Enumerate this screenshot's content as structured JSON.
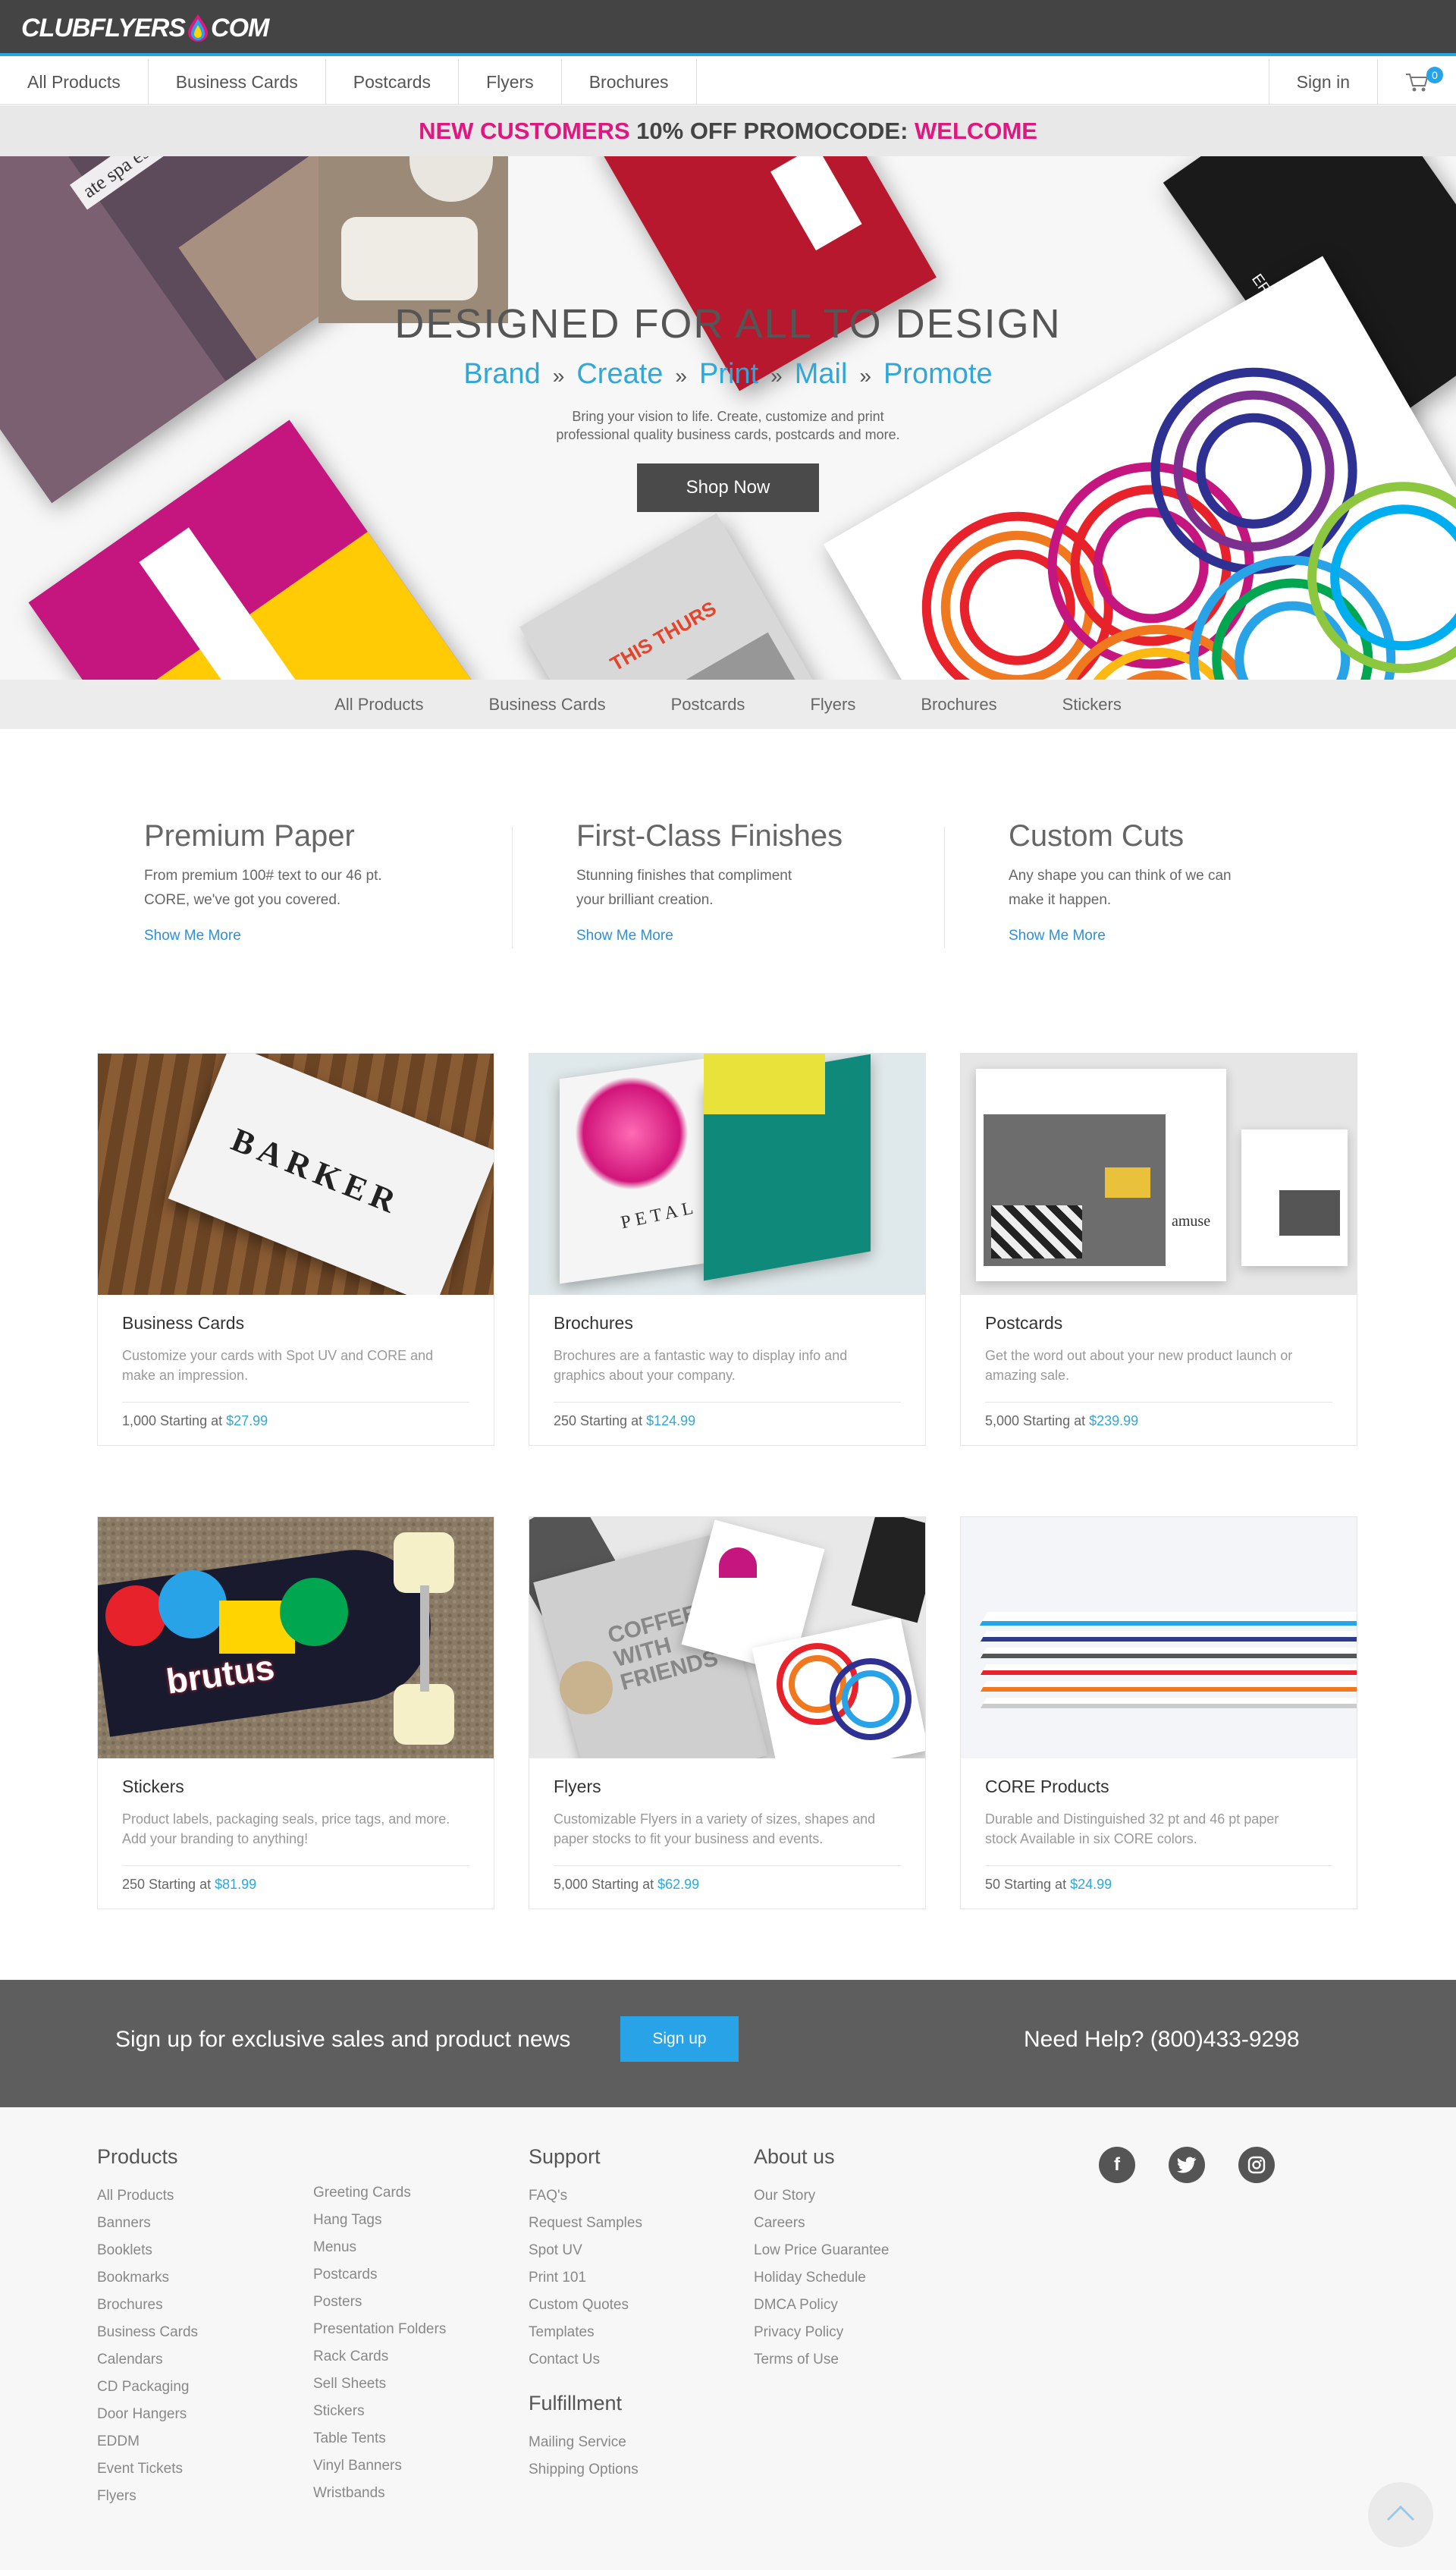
{
  "logo": {
    "text_left": "CLUBFLYERS",
    "text_right": "COM"
  },
  "nav": {
    "items": [
      {
        "label": "All Products"
      },
      {
        "label": "Business Cards"
      },
      {
        "label": "Postcards"
      },
      {
        "label": "Flyers"
      },
      {
        "label": "Brochures"
      }
    ],
    "signin": "Sign in",
    "cart_count": "0"
  },
  "promo": {
    "part1": "NEW CUSTOMERS",
    "part2": " 10% OFF PROMOCODE: ",
    "code": "WELCOME"
  },
  "hero": {
    "title": "DESIGNED FOR ALL TO DESIGN",
    "steps": [
      "Brand",
      "Create",
      "Print",
      "Mail",
      "Promote"
    ],
    "separator": "»",
    "desc_line1": "Bring your vision to life. Create, customize and print",
    "desc_line2": "professional quality business cards, postcards and more.",
    "cta": "Shop Now",
    "card_texts": {
      "spa": "ate spa escape",
      "jazz": "ER JAZZ BAR",
      "thurs": "THIS THURS"
    }
  },
  "subnav": [
    "All Products",
    "Business Cards",
    "Postcards",
    "Flyers",
    "Brochures",
    "Stickers"
  ],
  "features": [
    {
      "title": "Premium Paper",
      "line1": "From premium 100# text to our 46 pt.",
      "line2": "CORE, we've got you covered.",
      "link": "Show Me More"
    },
    {
      "title": "First-Class Finishes",
      "line1": "Stunning finishes that compliment",
      "line2": "your brilliant creation.",
      "link": "Show Me More"
    },
    {
      "title": "Custom Cuts",
      "line1": "Any shape you can think of we can",
      "line2": "make it happen.",
      "link": "Show Me More"
    }
  ],
  "products": [
    {
      "name": "Business Cards",
      "line1": "Customize your cards with Spot UV and CORE and",
      "line2": "make an impression.",
      "qty": "1,000 Starting at ",
      "price": "$27.99",
      "img_text": "BARKER"
    },
    {
      "name": "Brochures",
      "line1": "Brochures are a fantastic way to display info and",
      "line2": "graphics about your company.",
      "qty": "250 Starting at ",
      "price": "$124.99",
      "img_text": "PETAL"
    },
    {
      "name": "Postcards",
      "line1": "Get the word out about your new product launch or",
      "line2": "amazing sale.",
      "qty": "5,000 Starting at ",
      "price": "$239.99",
      "img_text": "amuse"
    },
    {
      "name": "Stickers",
      "line1": "Product labels, packaging seals, price tags, and more.",
      "line2": "Add your branding to anything!",
      "qty": "250 Starting at ",
      "price": "$81.99",
      "img_text": "brutus"
    },
    {
      "name": "Flyers",
      "line1": "Customizable Flyers in a variety of sizes, shapes and",
      "line2": "paper stocks to fit your business and events.",
      "qty": "5,000 Starting at ",
      "price": "$62.99",
      "img_text": "COFFEE WITH FRIENDS"
    },
    {
      "name": "CORE Products",
      "line1": "Durable and Distinguished 32 pt and 46 pt paper",
      "line2": "stock Available in six CORE colors.",
      "qty": "50 Starting at ",
      "price": "$24.99",
      "img_text": ""
    }
  ],
  "signup": {
    "text": "Sign up for exclusive sales and product news",
    "button": "Sign up",
    "help": "Need Help? (800)433-9298"
  },
  "footer": {
    "products_title": "Products",
    "products_col1": [
      "All Products",
      "Banners",
      "Booklets",
      "Bookmarks",
      "Brochures",
      "Business Cards",
      "Calendars",
      "CD Packaging",
      "Door Hangers",
      "EDDM",
      "Event Tickets",
      "Flyers"
    ],
    "products_col2": [
      "Greeting Cards",
      "Hang Tags",
      "Menus",
      "Postcards",
      "Posters",
      "Presentation Folders",
      "Rack Cards",
      "Sell Sheets",
      "Stickers",
      "Table Tents",
      "Vinyl Banners",
      "Wristbands"
    ],
    "support_title": "Support",
    "support": [
      "FAQ's",
      "Request Samples",
      "Spot UV",
      "Print 101",
      "Custom Quotes",
      "Templates",
      "Contact Us"
    ],
    "fulfillment_title": "Fulfillment",
    "fulfillment": [
      "Mailing Service",
      "Shipping Options"
    ],
    "about_title": "About us",
    "about": [
      "Our Story",
      "Careers",
      "Low Price Guarantee",
      "Holiday Schedule",
      "DMCA Policy",
      "Privacy Policy",
      "Terms of Use"
    ],
    "social": [
      "f",
      "t",
      "o"
    ]
  },
  "colors": {
    "accent": "#29a3e8",
    "promo_pink": "#e0177f",
    "dark": "#444444"
  }
}
